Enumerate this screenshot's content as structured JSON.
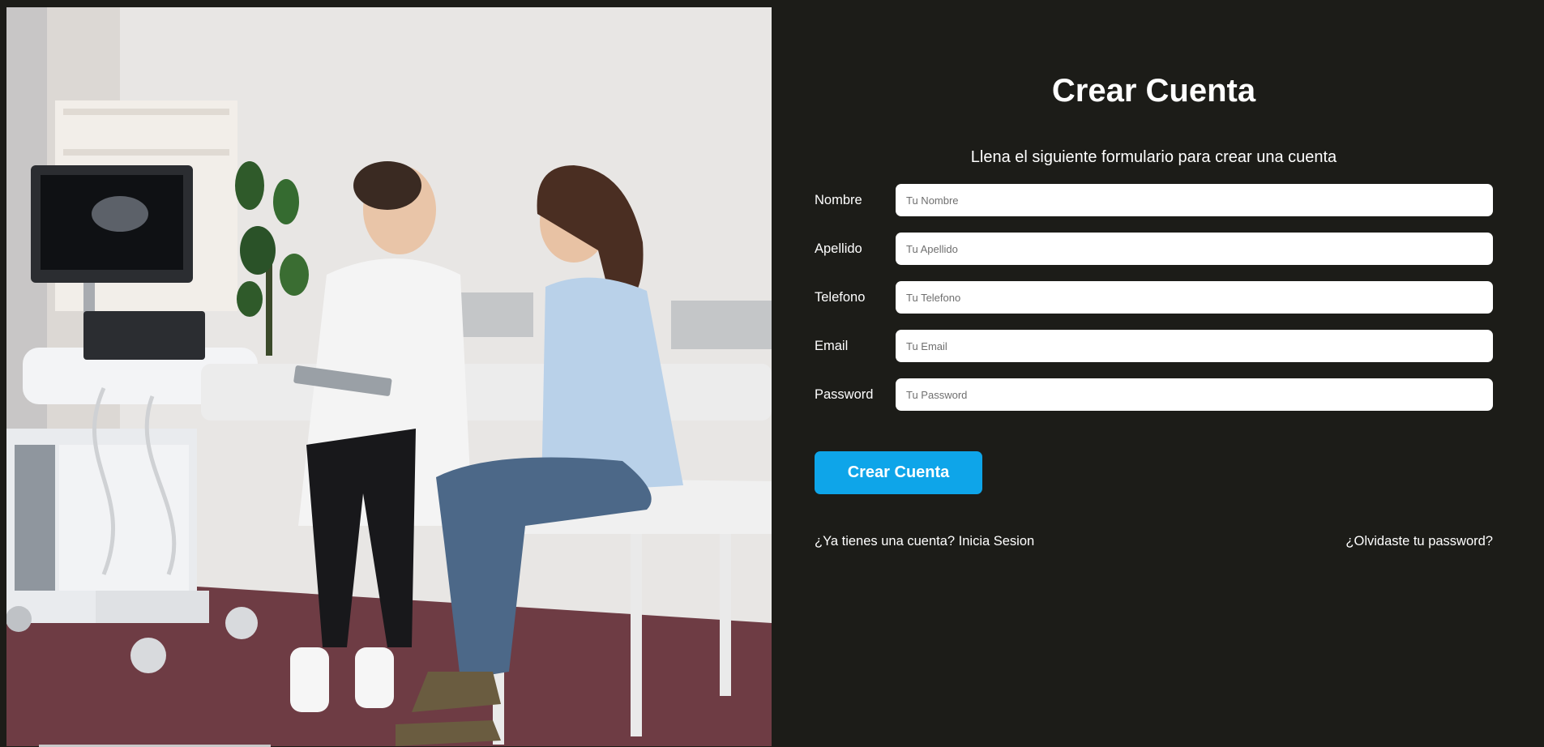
{
  "hero_image": {
    "description_icon": "doctor-patient-consultation-photo"
  },
  "form": {
    "title": "Crear Cuenta",
    "subtitle": "Llena el siguiente formulario para crear una cuenta",
    "fields": [
      {
        "label": "Nombre",
        "placeholder": "Tu Nombre",
        "value": ""
      },
      {
        "label": "Apellido",
        "placeholder": "Tu Apellido",
        "value": ""
      },
      {
        "label": "Telefono",
        "placeholder": "Tu Telefono",
        "value": ""
      },
      {
        "label": "Email",
        "placeholder": "Tu Email",
        "value": ""
      },
      {
        "label": "Password",
        "placeholder": "Tu Password",
        "value": ""
      }
    ],
    "submit_label": "Crear Cuenta",
    "login_link": "¿Ya tienes una cuenta? Inicia Sesion",
    "forgot_link": "¿Olvidaste tu password?"
  },
  "colors": {
    "background": "#1c1c18",
    "accent": "#0ea5e9",
    "text": "#ffffff",
    "input_background": "#ffffff"
  }
}
